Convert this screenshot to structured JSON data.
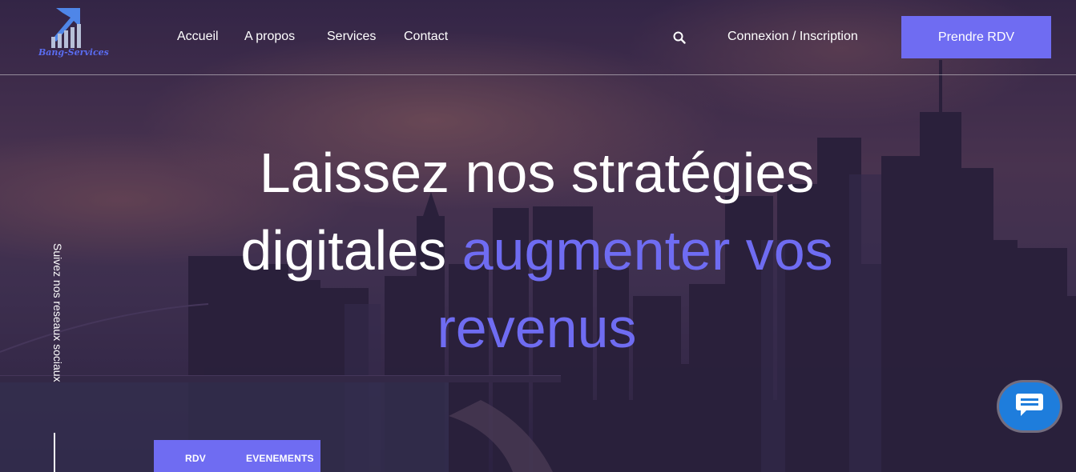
{
  "brand": {
    "name": "Bang-Services",
    "accent_color": "#6f6cf2"
  },
  "nav": {
    "items": [
      {
        "label": "Accueil"
      },
      {
        "label": "A propos"
      },
      {
        "label": "Services"
      },
      {
        "label": "Contact"
      }
    ]
  },
  "header": {
    "search_icon": "search-icon",
    "login_label": "Connexion / Inscription",
    "cta_label": "Prendre RDV"
  },
  "hero": {
    "title_line1": "Laissez nos stratégies",
    "title_line2_prefix": "digitales ",
    "title_accent": "augmenter vos revenus"
  },
  "social": {
    "label": "Suivez nos reseaux sociaux"
  },
  "tabs": [
    {
      "label": "RDV"
    },
    {
      "label": "EVENEMENTS"
    }
  ],
  "chat": {
    "icon": "chat-bubble-icon"
  }
}
